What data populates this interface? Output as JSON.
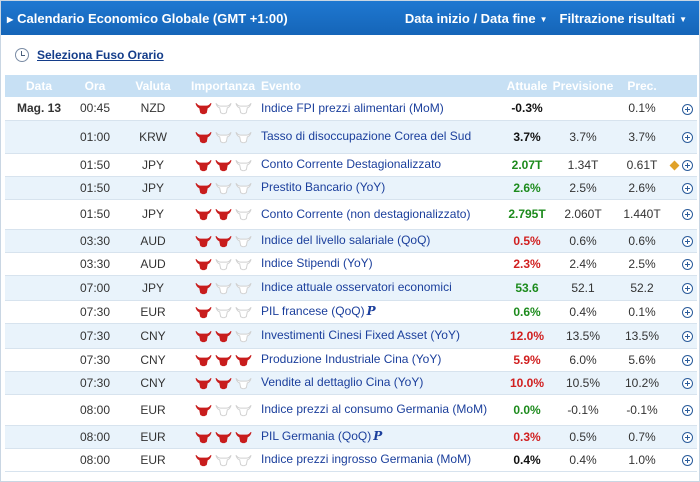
{
  "header": {
    "title": "Calendario Economico Globale (GMT +1:00)",
    "date_menu": "Data inizio / Data fine",
    "filter_menu": "Filtrazione risultati"
  },
  "timezone_link": "Seleziona Fuso Orario",
  "columns": {
    "date": "Data",
    "time": "Ora",
    "currency": "Valuta",
    "importance": "Importanza",
    "event": "Evento",
    "actual": "Attuale",
    "forecast": "Previsione",
    "previous": "Prec."
  },
  "colors": {
    "header_bar": "#1f78d1",
    "positive": "#1d8b1d",
    "negative": "#d11f1f",
    "bull_active": "#c81d1d",
    "bull_inactive": "#d0d0d0"
  },
  "rows": [
    {
      "date": "Mag. 13",
      "time": "00:45",
      "currency": "NZD",
      "importance": 1,
      "event": "Indice FPI prezzi alimentari (MoM)",
      "actual": "-0.3%",
      "actual_trend": "neutral",
      "forecast": "",
      "previous": "0.1%",
      "prelim": false,
      "revised": false
    },
    {
      "date": "",
      "time": "01:00",
      "currency": "KRW",
      "importance": 1,
      "event": "Tasso di disoccupazione Corea del Sud",
      "actual": "3.7%",
      "actual_trend": "neutral",
      "forecast": "3.7%",
      "previous": "3.7%",
      "prelim": false,
      "revised": false
    },
    {
      "date": "",
      "time": "01:50",
      "currency": "JPY",
      "importance": 2,
      "event": "Conto Corrente Destagionalizzato",
      "actual": "2.07T",
      "actual_trend": "positive",
      "forecast": "1.34T",
      "previous": "0.61T",
      "prelim": false,
      "revised": true
    },
    {
      "date": "",
      "time": "01:50",
      "currency": "JPY",
      "importance": 1,
      "event": "Prestito Bancario (YoY)",
      "actual": "2.6%",
      "actual_trend": "positive",
      "forecast": "2.5%",
      "previous": "2.6%",
      "prelim": false,
      "revised": false
    },
    {
      "date": "",
      "time": "01:50",
      "currency": "JPY",
      "importance": 2,
      "event": "Conto Corrente (non destagionalizzato)",
      "actual": "2.795T",
      "actual_trend": "positive",
      "forecast": "2.060T",
      "previous": "1.440T",
      "prelim": false,
      "revised": false
    },
    {
      "date": "",
      "time": "03:30",
      "currency": "AUD",
      "importance": 2,
      "event": "Indice del livello salariale (QoQ)",
      "actual": "0.5%",
      "actual_trend": "negative",
      "forecast": "0.6%",
      "previous": "0.6%",
      "prelim": false,
      "revised": false
    },
    {
      "date": "",
      "time": "03:30",
      "currency": "AUD",
      "importance": 1,
      "event": "Indice Stipendi (YoY)",
      "actual": "2.3%",
      "actual_trend": "negative",
      "forecast": "2.4%",
      "previous": "2.5%",
      "prelim": false,
      "revised": false
    },
    {
      "date": "",
      "time": "07:00",
      "currency": "JPY",
      "importance": 1,
      "event": "Indice attuale osservatori economici",
      "actual": "53.6",
      "actual_trend": "positive",
      "forecast": "52.1",
      "previous": "52.2",
      "prelim": false,
      "revised": false
    },
    {
      "date": "",
      "time": "07:30",
      "currency": "EUR",
      "importance": 1,
      "event": "PIL francese (QoQ)",
      "actual": "0.6%",
      "actual_trend": "positive",
      "forecast": "0.4%",
      "previous": "0.1%",
      "prelim": true,
      "revised": false
    },
    {
      "date": "",
      "time": "07:30",
      "currency": "CNY",
      "importance": 2,
      "event": "Investimenti Cinesi Fixed Asset (YoY)",
      "actual": "12.0%",
      "actual_trend": "negative",
      "forecast": "13.5%",
      "previous": "13.5%",
      "prelim": false,
      "revised": false
    },
    {
      "date": "",
      "time": "07:30",
      "currency": "CNY",
      "importance": 3,
      "event": "Produzione Industriale Cina (YoY)",
      "actual": "5.9%",
      "actual_trend": "negative",
      "forecast": "6.0%",
      "previous": "5.6%",
      "prelim": false,
      "revised": false
    },
    {
      "date": "",
      "time": "07:30",
      "currency": "CNY",
      "importance": 2,
      "event": "Vendite al dettaglio Cina (YoY)",
      "actual": "10.0%",
      "actual_trend": "negative",
      "forecast": "10.5%",
      "previous": "10.2%",
      "prelim": false,
      "revised": false
    },
    {
      "date": "",
      "time": "08:00",
      "currency": "EUR",
      "importance": 1,
      "event": "Indice prezzi al consumo Germania (MoM)",
      "actual": "0.0%",
      "actual_trend": "positive",
      "forecast": "-0.1%",
      "previous": "-0.1%",
      "prelim": false,
      "revised": false
    },
    {
      "date": "",
      "time": "08:00",
      "currency": "EUR",
      "importance": 3,
      "event": "PIL Germania (QoQ)",
      "actual": "0.3%",
      "actual_trend": "negative",
      "forecast": "0.5%",
      "previous": "0.7%",
      "prelim": true,
      "revised": false
    },
    {
      "date": "",
      "time": "08:00",
      "currency": "EUR",
      "importance": 1,
      "event": "Indice prezzi ingrosso Germania (MoM)",
      "actual": "0.4%",
      "actual_trend": "neutral",
      "forecast": "0.4%",
      "previous": "1.0%",
      "prelim": false,
      "revised": false
    }
  ]
}
